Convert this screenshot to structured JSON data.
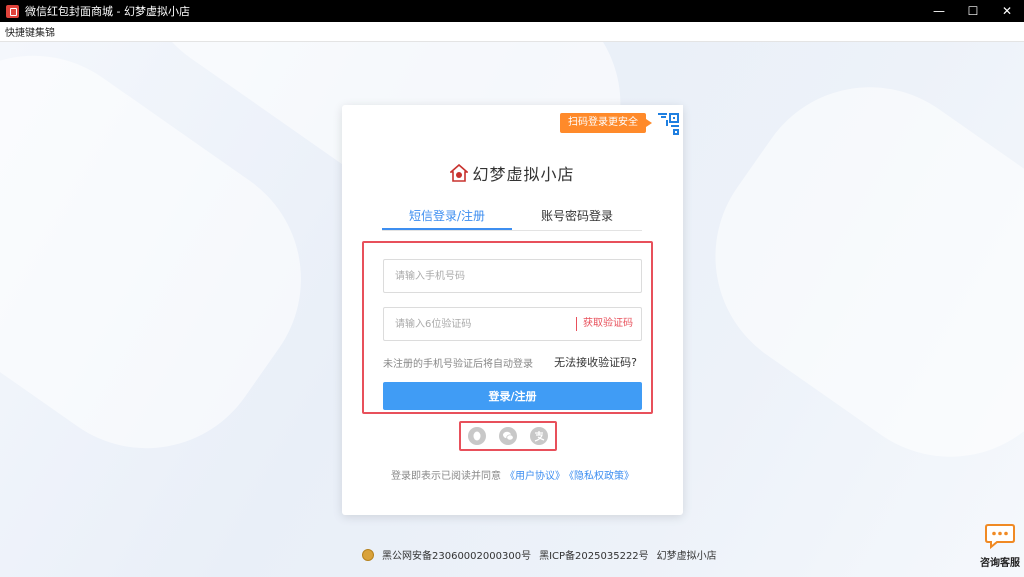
{
  "window": {
    "title": "微信红包封面商城 - 幻梦虚拟小店",
    "controls": {
      "minimize": "—",
      "maximize": "☐",
      "close": "✕"
    }
  },
  "menu": {
    "shortcuts": "快捷键集锦"
  },
  "qr": {
    "tip": "扫码登录更安全"
  },
  "brand": {
    "name": "幻梦虚拟小店"
  },
  "tabs": [
    {
      "label": "短信登录/注册",
      "active": true
    },
    {
      "label": "账号密码登录",
      "active": false
    }
  ],
  "form": {
    "phone_placeholder": "请输入手机号码",
    "code_placeholder": "请输入6位验证码",
    "get_code": "获取验证码",
    "hint": "未注册的手机号验证后将自动登录",
    "no_code": "无法接收验证码?",
    "submit": "登录/注册"
  },
  "social": [
    "qq-icon",
    "wechat-icon",
    "alipay-icon"
  ],
  "agreement": {
    "prefix": "登录即表示已阅读并同意",
    "user_agreement": "《用户协议》",
    "privacy": "《隐私权政策》"
  },
  "footer": {
    "police": "黑公网安备23060002000300号",
    "icp": "黑ICP备2025035222号",
    "shop": "幻梦虚拟小店"
  },
  "consult": {
    "label": "咨询客服"
  },
  "colors": {
    "accent": "#409cf5",
    "highlight": "#e8505b",
    "tip": "#ff8a2a"
  }
}
